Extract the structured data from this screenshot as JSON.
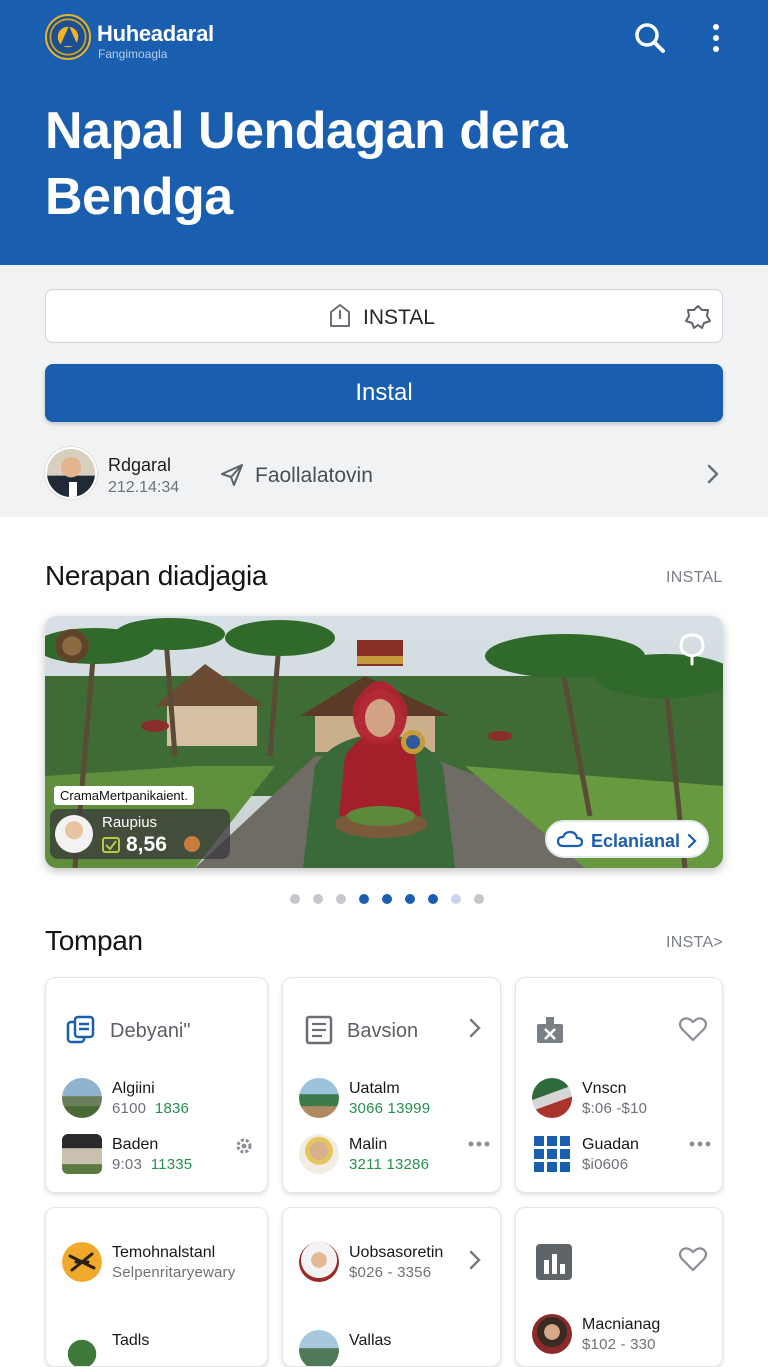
{
  "header": {
    "app_name": "Huheadaral",
    "app_subtitle": "Fangimoagla",
    "hero_title": "Napal Uendagan dera Bendga",
    "icons": [
      "logo",
      "search-icon",
      "more-vertical-icon"
    ]
  },
  "install_field": {
    "value": "INSTAL",
    "icons": [
      "info-icon",
      "badge-icon"
    ]
  },
  "primary_button": {
    "label": "Instal"
  },
  "user_row": {
    "name": "Rdgaral",
    "time": "212.14:34",
    "action": "Faollalatovin",
    "icons": [
      "send-icon",
      "chevron-right-icon"
    ]
  },
  "featured": {
    "title": "Nerapan diadjagia",
    "link": "INSTAL",
    "caption_line": "CramaMertpanikaient.",
    "caption_name": "Raupius",
    "caption_value": "8,56",
    "chip_label": "Eclanianal",
    "slides_total": 9,
    "slide_active": 4,
    "icons": [
      "seal-icon",
      "pin-icon",
      "cloud-icon",
      "chevron-right-icon"
    ]
  },
  "section2": {
    "title": "Tompan",
    "link": "INSTA>"
  },
  "cards": [
    {
      "title": "Debyani\"",
      "icon": "document-stack-icon",
      "items": [
        {
          "name": "Algiini",
          "val_a": "6100",
          "val_b": "1836"
        },
        {
          "name": "Baden",
          "val_a": "9:03",
          "val_b": "11335"
        }
      ]
    },
    {
      "title": "Bavsion",
      "icon": "form-icon",
      "items": [
        {
          "name": "Uatalm",
          "value": "3066 13999"
        },
        {
          "name": "Malin",
          "value": "3211 13286"
        }
      ]
    },
    {
      "title": "",
      "icon": "box-icon",
      "items": [
        {
          "name": "Vnscn",
          "value": "$:06 -$10"
        },
        {
          "name": "Guadan",
          "value": "$i0606"
        }
      ]
    },
    {
      "title": "",
      "icon": "seal-icon",
      "items": [
        {
          "name": "Temohnalstanl",
          "value": "Selpenritaryewary"
        },
        {
          "name": "Tadls",
          "value": ""
        }
      ]
    },
    {
      "title": "",
      "icon": "person-icon",
      "items": [
        {
          "name": "Uobsasoretin",
          "value": "$026 - 3356"
        },
        {
          "name": "Vallas",
          "value": ""
        }
      ]
    },
    {
      "title": "",
      "icon": "chart-box-icon",
      "items": [
        {
          "name": "Macnianag",
          "value": "$102 - 330"
        }
      ]
    }
  ],
  "colors": {
    "brand_blue": "#1a5eb0",
    "band_gray": "#f1f2f4",
    "value_green": "#26914b"
  }
}
